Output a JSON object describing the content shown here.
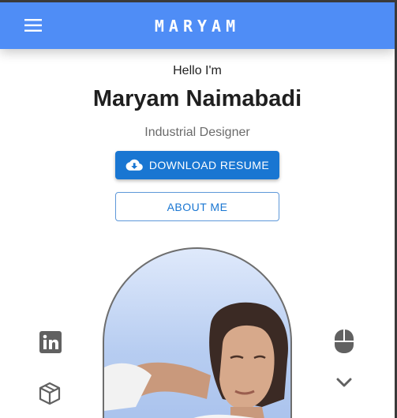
{
  "appbar": {
    "brand": "MARYAM",
    "menu_icon": "menu-icon",
    "color": "#4f8df6"
  },
  "hero": {
    "greeting": "Hello I'm",
    "name": "Maryam Naimabadi",
    "role": "Industrial Designer"
  },
  "buttons": {
    "download": {
      "label": "DOWNLOAD RESUME",
      "icon": "cloud-download-icon",
      "color": "#1976d2"
    },
    "about": {
      "label": "ABOUT ME",
      "color": "#1976d2"
    }
  },
  "social": {
    "left": [
      "linkedin-icon",
      "cube-3d-icon"
    ],
    "right": [
      "mouse-icon",
      "chevron-down-icon"
    ]
  }
}
